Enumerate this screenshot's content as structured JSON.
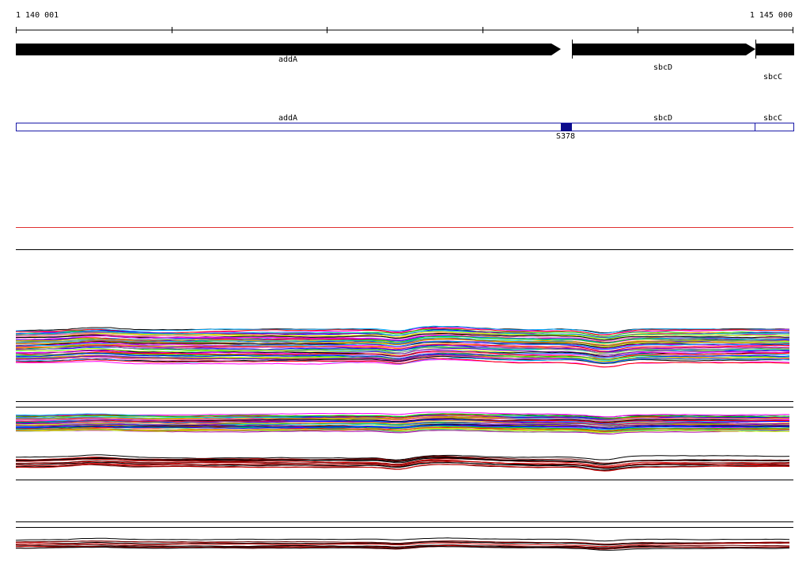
{
  "ruler": {
    "start_label": "1 140 001",
    "end_label": "1 145 000"
  },
  "genes": [
    {
      "name": "addA",
      "color": "#000000"
    },
    {
      "name": "sbcD",
      "color": "#000000"
    },
    {
      "name": "sbcC",
      "color": "#000000"
    }
  ],
  "annotation_track": {
    "border_color": "#1a1aa8",
    "genes": [
      {
        "name": "addA"
      },
      {
        "name": "sbcD"
      },
      {
        "name": "sbcC"
      }
    ],
    "feature": {
      "name": "S378",
      "color": "#0c0c8c"
    }
  },
  "colors": {
    "threshold": "#e03030",
    "separator": "#000000",
    "red_profile": "#cc0000"
  }
}
